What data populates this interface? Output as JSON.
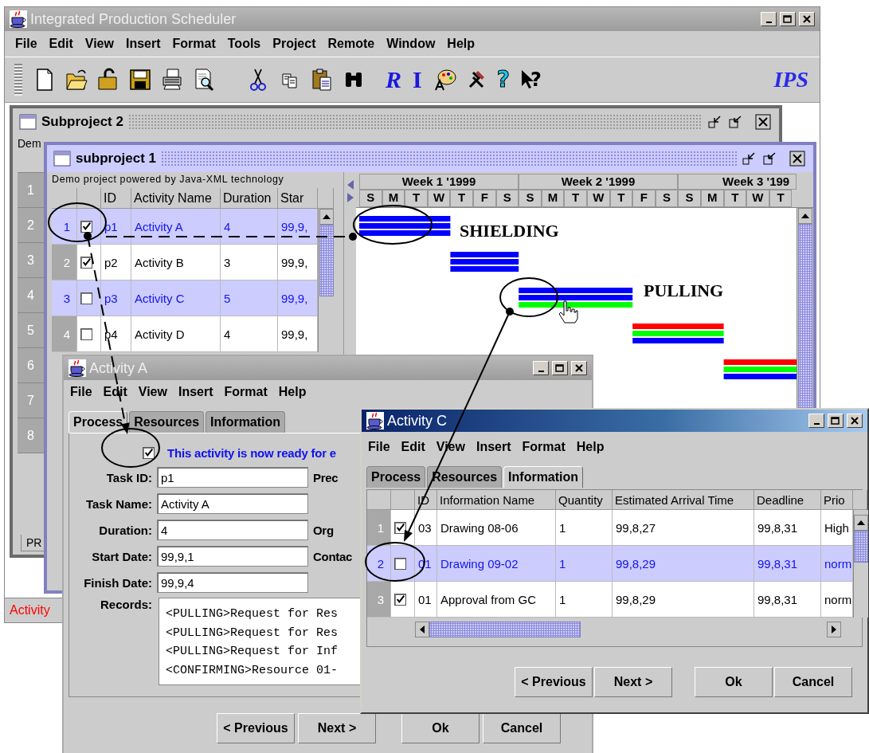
{
  "main_window": {
    "title": "Integrated Production Scheduler",
    "menu": [
      "File",
      "Edit",
      "View",
      "Insert",
      "Format",
      "Tools",
      "Project",
      "Remote",
      "Window",
      "Help"
    ],
    "toolbar_glyphs": [
      "R",
      "I",
      "?",
      "?"
    ],
    "logo": "IPS",
    "status_text": "Activity"
  },
  "subproject_2": {
    "title": "Subproject 2",
    "caption": "Dem",
    "row_numbers": [
      "1",
      "2",
      "3",
      "4",
      "5",
      "6",
      "7",
      "8"
    ],
    "tab": "PR"
  },
  "subproject_1": {
    "title": "subproject 1",
    "caption": "Demo project powered by Java-XML technology",
    "columns": [
      "ID",
      "Activity Name",
      "Duration",
      "Star"
    ],
    "rows": [
      {
        "number": "1",
        "ready": true,
        "id": "p1",
        "name": "Activity A",
        "duration": "4",
        "start": "99,9,",
        "selected": true
      },
      {
        "number": "2",
        "ready": true,
        "id": "p2",
        "name": "Activity B",
        "duration": "3",
        "start": "99,9,",
        "selected": false
      },
      {
        "number": "3",
        "ready": false,
        "id": "p3",
        "name": "Activity C",
        "duration": "5",
        "start": "99,9,",
        "selected": true
      },
      {
        "number": "4",
        "ready": false,
        "id": "p4",
        "name": "Activity D",
        "duration": "4",
        "start": "99,9,",
        "selected": false
      }
    ],
    "weeks": [
      "Week 1 '1999",
      "Week 2 '1999",
      "Week 3 '199"
    ],
    "days": [
      "S",
      "M",
      "T",
      "W",
      "T",
      "F",
      "S",
      "S",
      "M",
      "T",
      "W",
      "T",
      "F",
      "S",
      "S",
      "M",
      "T",
      "W",
      "T"
    ],
    "bars": [
      {
        "stripes": [
          {
            "color": "#0000ff"
          },
          {
            "color": "#0000ff"
          },
          {
            "color": "#0000ff"
          }
        ]
      },
      {
        "stripes": [
          {
            "color": "#0000ff"
          },
          {
            "color": "#0000ff"
          },
          {
            "color": "#0000ff"
          }
        ]
      },
      {
        "stripes": [
          {
            "color": "#0000ff"
          },
          {
            "color": "#0000ff"
          },
          {
            "color": "#00ff00"
          }
        ]
      },
      {
        "stripes": [
          {
            "color": "#ff0000"
          },
          {
            "color": "#00ff00"
          },
          {
            "color": "#0000ff"
          }
        ]
      },
      {
        "stripes": [
          {
            "color": "#ff0000"
          },
          {
            "color": "#00ff00"
          },
          {
            "color": "#0000ff"
          }
        ]
      }
    ]
  },
  "annotations": [
    "SHIELDING",
    "PULLING"
  ],
  "activity_a": {
    "title": "Activity A",
    "menu": [
      "File",
      "Edit",
      "View",
      "Insert",
      "Format",
      "Help"
    ],
    "tabs": [
      {
        "label": "Process",
        "selected": true
      },
      {
        "label": "Resources",
        "selected": false
      },
      {
        "label": "Information",
        "selected": false
      }
    ],
    "ready": true,
    "ready_label": "This activity is now ready for e",
    "fields": [
      {
        "label": "Task ID:",
        "value": "p1",
        "side_label": "Prec"
      },
      {
        "label": "Task Name:",
        "value": "Activity A"
      },
      {
        "label": "Duration:",
        "value": "4",
        "side_label": "Org"
      },
      {
        "label": "Start Date:",
        "value": "99,9,1",
        "side_label": "Contac"
      },
      {
        "label": "Finish Date:",
        "value": "99,9,4"
      }
    ],
    "records_label": "Records:",
    "records": [
      "<PULLING>Request for Res",
      "<PULLING>Request for Res",
      "<PULLING>Request for Inf",
      "<CONFIRMING>Resource 01-"
    ],
    "buttons": [
      "< Previous",
      "Next >",
      "Ok",
      "Cancel"
    ]
  },
  "activity_c": {
    "title": "Activity C",
    "menu": [
      "File",
      "Edit",
      "View",
      "Insert",
      "Format",
      "Help"
    ],
    "tabs": [
      {
        "label": "Process",
        "selected": false
      },
      {
        "label": "Resources",
        "selected": false
      },
      {
        "label": "Information",
        "selected": true
      }
    ],
    "columns": [
      "ID",
      "Information Name",
      "Quantity",
      "Estimated Arrival Time",
      "Deadline",
      "Prio"
    ],
    "rows": [
      {
        "number": "1",
        "checked": true,
        "id": "03",
        "name": "Drawing 08-06",
        "quantity": "1",
        "arrival": "99,8,27",
        "deadline": "99,8,31",
        "priority": "High",
        "selected": false
      },
      {
        "number": "2",
        "checked": false,
        "id": "01",
        "name": "Drawing 09-02",
        "quantity": "1",
        "arrival": "99,8,29",
        "deadline": "99,8,31",
        "priority": "norm",
        "selected": true
      },
      {
        "number": "3",
        "checked": true,
        "id": "01",
        "name": "Approval from GC",
        "quantity": "1",
        "arrival": "99,8,29",
        "deadline": "99,8,31",
        "priority": "norm",
        "selected": false
      }
    ],
    "buttons": [
      "< Previous",
      "Next >",
      "Ok",
      "Cancel"
    ]
  }
}
